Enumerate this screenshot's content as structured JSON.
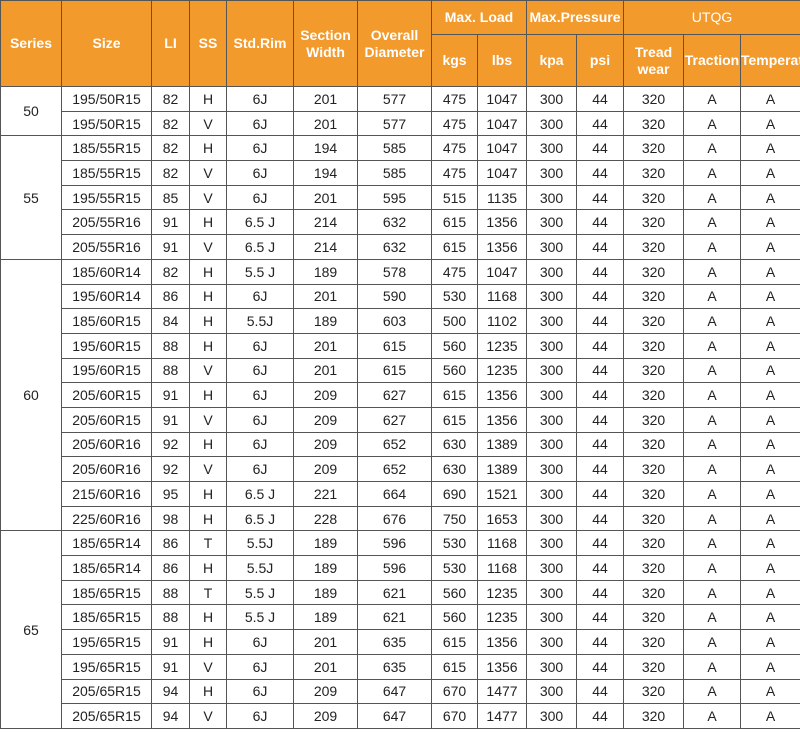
{
  "headers": {
    "series": "Series",
    "size": "Size",
    "li": "LI",
    "ss": "SS",
    "std_rim": "Std.Rim",
    "section_width": "Section Width",
    "overall_diameter": "Overall Diameter",
    "max_load": "Max. Load",
    "max_pressure": "Max.Pressure",
    "utqg": "UTQG",
    "kgs": "kgs",
    "lbs": "lbs",
    "kpa": "kpa",
    "psi": "psi",
    "treadwear": "Tread wear",
    "traction": "Traction",
    "temperature": "Temperature"
  },
  "groups": [
    {
      "series": "50",
      "rows": [
        [
          "195/50R15",
          "82",
          "H",
          "6J",
          "201",
          "577",
          "475",
          "1047",
          "300",
          "44",
          "320",
          "A",
          "A"
        ],
        [
          "195/50R15",
          "82",
          "V",
          "6J",
          "201",
          "577",
          "475",
          "1047",
          "300",
          "44",
          "320",
          "A",
          "A"
        ]
      ]
    },
    {
      "series": "55",
      "rows": [
        [
          "185/55R15",
          "82",
          "H",
          "6J",
          "194",
          "585",
          "475",
          "1047",
          "300",
          "44",
          "320",
          "A",
          "A"
        ],
        [
          "185/55R15",
          "82",
          "V",
          "6J",
          "194",
          "585",
          "475",
          "1047",
          "300",
          "44",
          "320",
          "A",
          "A"
        ],
        [
          "195/55R15",
          "85",
          "V",
          "6J",
          "201",
          "595",
          "515",
          "1135",
          "300",
          "44",
          "320",
          "A",
          "A"
        ],
        [
          "205/55R16",
          "91",
          "H",
          "6.5 J",
          "214",
          "632",
          "615",
          "1356",
          "300",
          "44",
          "320",
          "A",
          "A"
        ],
        [
          "205/55R16",
          "91",
          "V",
          "6.5 J",
          "214",
          "632",
          "615",
          "1356",
          "300",
          "44",
          "320",
          "A",
          "A"
        ]
      ]
    },
    {
      "series": "60",
      "rows": [
        [
          "185/60R14",
          "82",
          "H",
          "5.5 J",
          "189",
          "578",
          "475",
          "1047",
          "300",
          "44",
          "320",
          "A",
          "A"
        ],
        [
          "195/60R14",
          "86",
          "H",
          "6J",
          "201",
          "590",
          "530",
          "1168",
          "300",
          "44",
          "320",
          "A",
          "A"
        ],
        [
          "185/60R15",
          "84",
          "H",
          "5.5J",
          "189",
          "603",
          "500",
          "1102",
          "300",
          "44",
          "320",
          "A",
          "A"
        ],
        [
          "195/60R15",
          "88",
          "H",
          "6J",
          "201",
          "615",
          "560",
          "1235",
          "300",
          "44",
          "320",
          "A",
          "A"
        ],
        [
          "195/60R15",
          "88",
          "V",
          "6J",
          "201",
          "615",
          "560",
          "1235",
          "300",
          "44",
          "320",
          "A",
          "A"
        ],
        [
          "205/60R15",
          "91",
          "H",
          "6J",
          "209",
          "627",
          "615",
          "1356",
          "300",
          "44",
          "320",
          "A",
          "A"
        ],
        [
          "205/60R15",
          "91",
          "V",
          "6J",
          "209",
          "627",
          "615",
          "1356",
          "300",
          "44",
          "320",
          "A",
          "A"
        ],
        [
          "205/60R16",
          "92",
          "H",
          "6J",
          "209",
          "652",
          "630",
          "1389",
          "300",
          "44",
          "320",
          "A",
          "A"
        ],
        [
          "205/60R16",
          "92",
          "V",
          "6J",
          "209",
          "652",
          "630",
          "1389",
          "300",
          "44",
          "320",
          "A",
          "A"
        ],
        [
          "215/60R16",
          "95",
          "H",
          "6.5 J",
          "221",
          "664",
          "690",
          "1521",
          "300",
          "44",
          "320",
          "A",
          "A"
        ],
        [
          "225/60R16",
          "98",
          "H",
          "6.5 J",
          "228",
          "676",
          "750",
          "1653",
          "300",
          "44",
          "320",
          "A",
          "A"
        ]
      ]
    },
    {
      "series": "65",
      "rows": [
        [
          "185/65R14",
          "86",
          "T",
          "5.5J",
          "189",
          "596",
          "530",
          "1168",
          "300",
          "44",
          "320",
          "A",
          "A"
        ],
        [
          "185/65R14",
          "86",
          "H",
          "5.5J",
          "189",
          "596",
          "530",
          "1168",
          "300",
          "44",
          "320",
          "A",
          "A"
        ],
        [
          "185/65R15",
          "88",
          "T",
          "5.5 J",
          "189",
          "621",
          "560",
          "1235",
          "300",
          "44",
          "320",
          "A",
          "A"
        ],
        [
          "185/65R15",
          "88",
          "H",
          "5.5 J",
          "189",
          "621",
          "560",
          "1235",
          "300",
          "44",
          "320",
          "A",
          "A"
        ],
        [
          "195/65R15",
          "91",
          "H",
          "6J",
          "201",
          "635",
          "615",
          "1356",
          "300",
          "44",
          "320",
          "A",
          "A"
        ],
        [
          "195/65R15",
          "91",
          "V",
          "6J",
          "201",
          "635",
          "615",
          "1356",
          "300",
          "44",
          "320",
          "A",
          "A"
        ],
        [
          "205/65R15",
          "94",
          "H",
          "6J",
          "209",
          "647",
          "670",
          "1477",
          "300",
          "44",
          "320",
          "A",
          "A"
        ],
        [
          "205/65R15",
          "94",
          "V",
          "6J",
          "209",
          "647",
          "670",
          "1477",
          "300",
          "44",
          "320",
          "A",
          "A"
        ]
      ]
    }
  ],
  "colors": {
    "header_bg": "#f39a2c",
    "header_text": "#ffffff",
    "border": "#555555"
  }
}
